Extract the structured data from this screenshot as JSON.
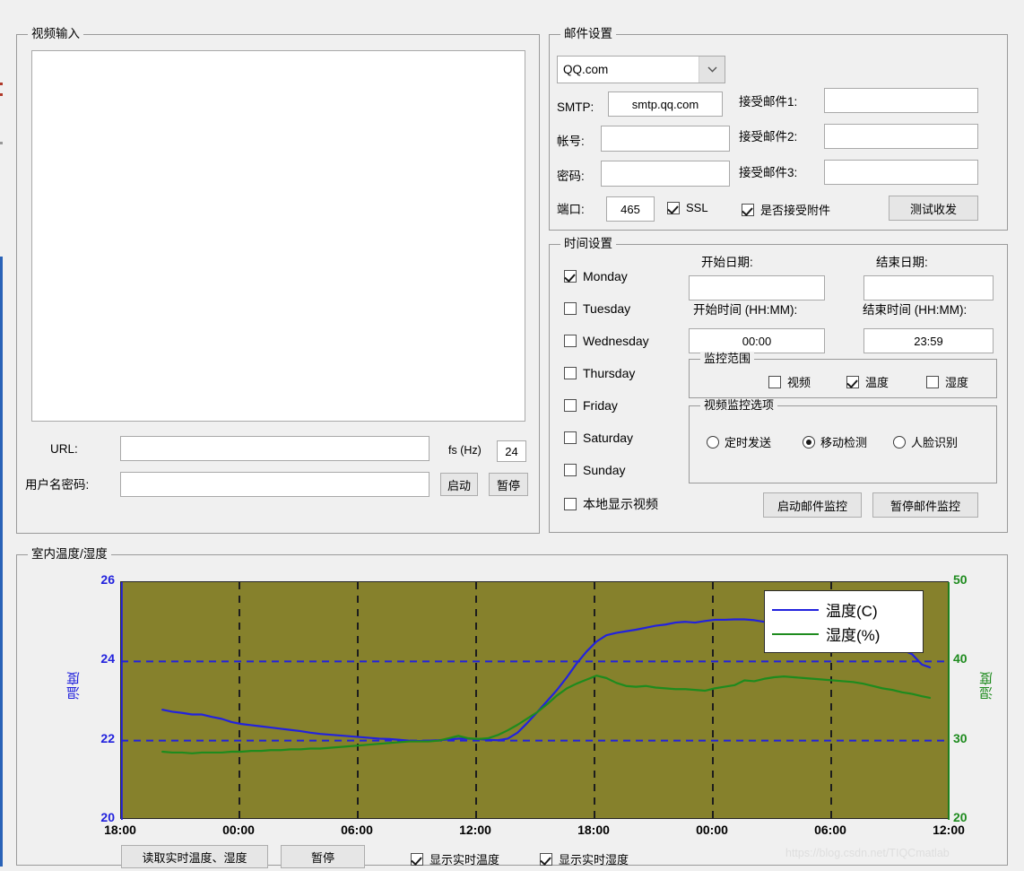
{
  "video_input": {
    "title": "视频输入",
    "url_label": "URL:",
    "url_value": "",
    "credentials_label": "用户名密码:",
    "credentials_value": "",
    "fs_label": "fs (Hz)",
    "fs_value": "24",
    "start_button": "启动",
    "pause_button": "暂停"
  },
  "mail_settings": {
    "title": "邮件设置",
    "provider_selected": "QQ.com",
    "smtp_label": "SMTP:",
    "smtp_value": "smtp.qq.com",
    "account_label": "帐号:",
    "account_value": "",
    "password_label": "密码:",
    "password_value": "",
    "recipient1_label": "接受邮件1:",
    "recipient1_value": "",
    "recipient2_label": "接受邮件2:",
    "recipient2_value": "",
    "recipient3_label": "接受邮件3:",
    "recipient3_value": "",
    "port_label": "端口:",
    "port_value": "465",
    "ssl_label": "SSL",
    "ssl_checked": true,
    "attachment_label": "是否接受附件",
    "attachment_checked": true,
    "test_button": "测试收发"
  },
  "time_settings": {
    "title": "时间设置",
    "days": [
      {
        "label": "Monday",
        "checked": true
      },
      {
        "label": "Tuesday",
        "checked": false
      },
      {
        "label": "Wednesday",
        "checked": false
      },
      {
        "label": "Thursday",
        "checked": false
      },
      {
        "label": "Friday",
        "checked": false
      },
      {
        "label": "Saturday",
        "checked": false
      },
      {
        "label": "Sunday",
        "checked": false
      }
    ],
    "local_display_label": "本地显示视频",
    "local_display_checked": false,
    "start_date_label": "开始日期:",
    "start_date_value": "",
    "end_date_label": "结束日期:",
    "end_date_value": "",
    "start_time_label": "开始时间 (HH:MM):",
    "start_time_value": "00:00",
    "end_time_label": "结束时间 (HH:MM):",
    "end_time_value": "23:59",
    "monitor_scope": {
      "title": "监控范围",
      "items": [
        {
          "label": "视频",
          "checked": false
        },
        {
          "label": "温度",
          "checked": true
        },
        {
          "label": "湿度",
          "checked": false
        }
      ]
    },
    "video_options": {
      "title": "视频监控选项",
      "items": [
        {
          "label": "定时发送",
          "selected": false
        },
        {
          "label": "移动检测",
          "selected": true
        },
        {
          "label": "人脸识别",
          "selected": false
        }
      ]
    },
    "start_mail_monitor_button": "启动邮件监控",
    "pause_mail_monitor_button": "暂停邮件监控"
  },
  "chart_panel": {
    "title": "室内温度/湿度",
    "read_button": "读取实时温度、湿度",
    "pause_button": "暂停",
    "show_temp_label": "显示实时温度",
    "show_temp_checked": true,
    "show_humidity_label": "显示实时湿度",
    "show_humidity_checked": true,
    "watermark": "https://blog.csdn.net/TIQCmatlab"
  },
  "colors": {
    "temperature": "#2222dd",
    "humidity": "#1e8b1e",
    "plot_background": "#86812c",
    "window_background": "#f0f0f0",
    "accent_blue": "#2a63b8"
  },
  "chart_data": {
    "type": "line",
    "title": "室内温度/湿度",
    "xlabel": "",
    "ylabel": "温度",
    "y2label": "湿度",
    "grid": true,
    "legend_position": "top-right",
    "x_tick_labels": [
      "18:00",
      "00:00",
      "06:00",
      "12:00",
      "18:00",
      "00:00",
      "06:00",
      "12:00"
    ],
    "x_tick_hours": [
      0,
      6,
      12,
      18,
      24,
      30,
      36,
      42
    ],
    "xlim_hours": [
      0,
      42
    ],
    "ylim": [
      20,
      26
    ],
    "y_ticks": [
      20,
      22,
      24,
      26
    ],
    "y2lim": [
      20,
      50
    ],
    "y2_ticks": [
      20,
      30,
      40,
      50
    ],
    "series": [
      {
        "name": "温度(C)",
        "color": "#2222dd",
        "axis": "left",
        "unit": "C",
        "x": [
          2.1,
          2.6,
          3.1,
          3.6,
          4.1,
          4.6,
          5.1,
          5.6,
          6.1,
          6.6,
          7.1,
          7.6,
          8.1,
          8.6,
          9.1,
          9.6,
          10.1,
          10.6,
          11.1,
          11.6,
          12.1,
          12.6,
          13.1,
          13.6,
          14.1,
          14.6,
          15.1,
          15.6,
          16.1,
          16.6,
          17.1,
          17.6,
          18.1,
          18.6,
          19.1,
          19.6,
          20.1,
          20.6,
          21.1,
          21.6,
          22.1,
          22.6,
          23.1,
          23.6,
          24.1,
          24.6,
          25.1,
          25.6,
          26.1,
          26.6,
          27.1,
          27.6,
          28.1,
          28.6,
          29.1,
          29.6,
          30.1,
          30.6,
          31.1,
          31.6,
          32.1,
          32.6,
          33.1,
          33.6,
          34.1,
          34.6,
          35.1,
          35.6,
          36.1,
          36.6,
          37.1,
          37.6,
          38.1,
          38.6,
          39.1,
          39.6,
          40.1,
          40.6,
          41.0
        ],
        "y": [
          22.78,
          22.73,
          22.7,
          22.66,
          22.66,
          22.6,
          22.55,
          22.47,
          22.42,
          22.39,
          22.36,
          22.33,
          22.3,
          22.27,
          22.24,
          22.2,
          22.17,
          22.15,
          22.13,
          22.11,
          22.09,
          22.07,
          22.05,
          22.04,
          22.02,
          22.0,
          21.99,
          22.0,
          22.01,
          22.03,
          22.05,
          22.05,
          22.04,
          22.02,
          22.01,
          22.05,
          22.2,
          22.45,
          22.72,
          23.0,
          23.28,
          23.6,
          23.95,
          24.25,
          24.5,
          24.66,
          24.72,
          24.76,
          24.8,
          24.85,
          24.9,
          24.93,
          24.98,
          25.0,
          24.98,
          25.02,
          25.05,
          25.05,
          25.06,
          25.06,
          25.04,
          25.0,
          24.96,
          24.95,
          24.94,
          24.93,
          24.92,
          24.91,
          24.92,
          24.92,
          24.88,
          24.8,
          24.68,
          24.54,
          24.42,
          24.3,
          24.18,
          23.92,
          23.85
        ]
      },
      {
        "name": "湿度(%)",
        "color": "#1e8b1e",
        "axis": "right",
        "unit": "%",
        "x": [
          2.1,
          2.6,
          3.1,
          3.6,
          4.1,
          4.6,
          5.1,
          5.6,
          6.1,
          6.6,
          7.1,
          7.6,
          8.1,
          8.6,
          9.1,
          9.6,
          10.1,
          10.6,
          11.1,
          11.6,
          12.1,
          12.6,
          13.1,
          13.6,
          14.1,
          14.6,
          15.1,
          15.6,
          16.1,
          16.6,
          17.1,
          17.6,
          18.1,
          18.6,
          19.1,
          19.6,
          20.1,
          20.6,
          21.1,
          21.6,
          22.1,
          22.6,
          23.1,
          23.6,
          24.1,
          24.6,
          25.1,
          25.6,
          26.1,
          26.6,
          27.1,
          27.6,
          28.1,
          28.6,
          29.1,
          29.6,
          30.1,
          30.6,
          31.1,
          31.6,
          32.1,
          32.6,
          33.1,
          33.6,
          34.1,
          34.6,
          35.1,
          35.6,
          36.1,
          36.6,
          37.1,
          37.6,
          38.1,
          38.6,
          39.1,
          39.6,
          40.1,
          40.6,
          41.0
        ],
        "y": [
          28.6,
          28.5,
          28.5,
          28.4,
          28.5,
          28.5,
          28.5,
          28.6,
          28.6,
          28.7,
          28.7,
          28.8,
          28.8,
          28.9,
          28.9,
          29.0,
          29.0,
          29.1,
          29.2,
          29.3,
          29.4,
          29.5,
          29.6,
          29.7,
          29.8,
          29.9,
          29.9,
          29.9,
          30.0,
          30.3,
          30.6,
          30.3,
          30.2,
          30.3,
          30.7,
          31.3,
          32.0,
          32.8,
          33.6,
          34.6,
          35.7,
          36.6,
          37.2,
          37.7,
          38.2,
          37.9,
          37.3,
          36.9,
          36.8,
          36.9,
          36.7,
          36.6,
          36.5,
          36.5,
          36.4,
          36.3,
          36.6,
          36.8,
          37.0,
          37.6,
          37.5,
          37.8,
          38.0,
          38.1,
          38.0,
          37.9,
          37.8,
          37.7,
          37.6,
          37.5,
          37.4,
          37.2,
          36.9,
          36.6,
          36.4,
          36.1,
          35.9,
          35.6,
          35.4
        ]
      }
    ]
  }
}
